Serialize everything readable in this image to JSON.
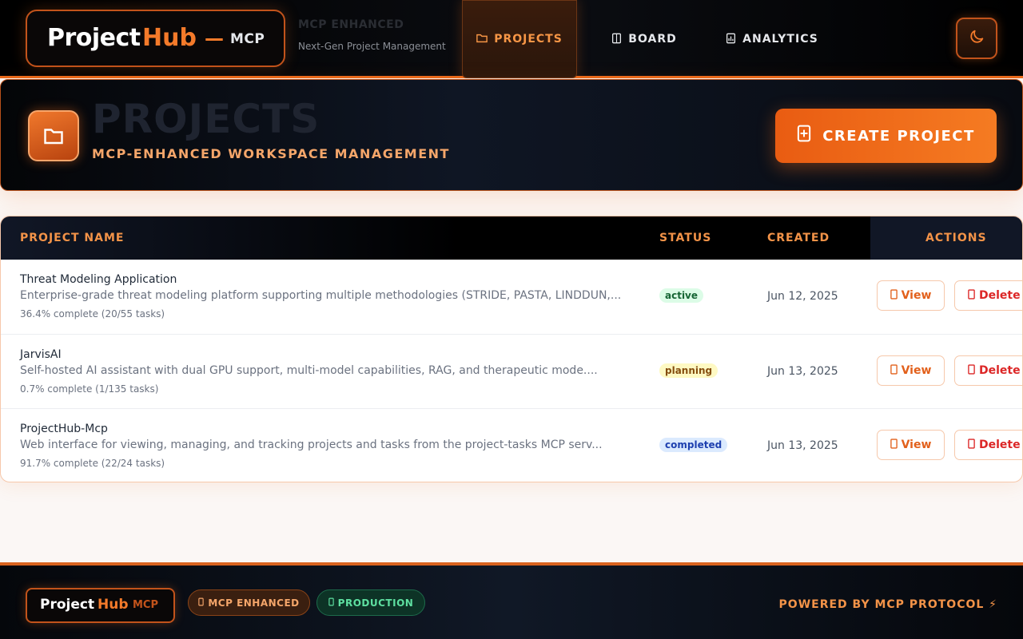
{
  "header": {
    "logo_project": "Project",
    "logo_hub": "Hub",
    "logo_dash": "—",
    "logo_mcp": "MCP",
    "tagline_title": "MCP ENHANCED",
    "tagline_sub": "Next-Gen Project Management",
    "nav": [
      {
        "label": "PROJECTS",
        "icon": "folder-icon",
        "active": true
      },
      {
        "label": "BOARD",
        "icon": "board-icon",
        "active": false
      },
      {
        "label": "ANALYTICS",
        "icon": "chart-icon",
        "active": false
      }
    ],
    "theme_toggle_icon": "moon-icon"
  },
  "page": {
    "title": "PROJECTS",
    "subtitle": "MCP-ENHANCED WORKSPACE MANAGEMENT",
    "create_label": "CREATE PROJECT"
  },
  "table": {
    "columns": [
      "PROJECT NAME",
      "STATUS",
      "CREATED",
      "ACTIONS"
    ],
    "view_label": "View",
    "delete_label": "Delete",
    "rows": [
      {
        "name": "Threat Modeling Application",
        "description": "Enterprise-grade threat modeling platform supporting multiple methodologies (STRIDE, PASTA, LINDDUN,...",
        "progress": "36.4% complete (20/55 tasks)",
        "status": "active",
        "created": "Jun 12, 2025"
      },
      {
        "name": "JarvisAI",
        "description": "Self-hosted AI assistant with dual GPU support, multi-model capabilities, RAG, and therapeutic mode....",
        "progress": "0.7% complete (1/135 tasks)",
        "status": "planning",
        "created": "Jun 13, 2025"
      },
      {
        "name": "ProjectHub-Mcp",
        "description": "Web interface for viewing, managing, and tracking projects and tasks from the project-tasks MCP serv...",
        "progress": "91.7% complete (22/24 tasks)",
        "status": "completed",
        "created": "Jun 13, 2025"
      }
    ]
  },
  "footer": {
    "logo_project": "Project",
    "logo_hub": "Hub",
    "logo_mcp": "MCP",
    "pill_mcp": "MCP ENHANCED",
    "pill_production": "PRODUCTION",
    "powered": "POWERED BY MCP PROTOCOL ⚡"
  },
  "colors": {
    "accent": "#f47a2a",
    "accent_dark": "#c2531b",
    "status_active": "#166534",
    "status_planning": "#854d0e",
    "status_completed": "#1e40af",
    "danger": "#dc2626"
  }
}
